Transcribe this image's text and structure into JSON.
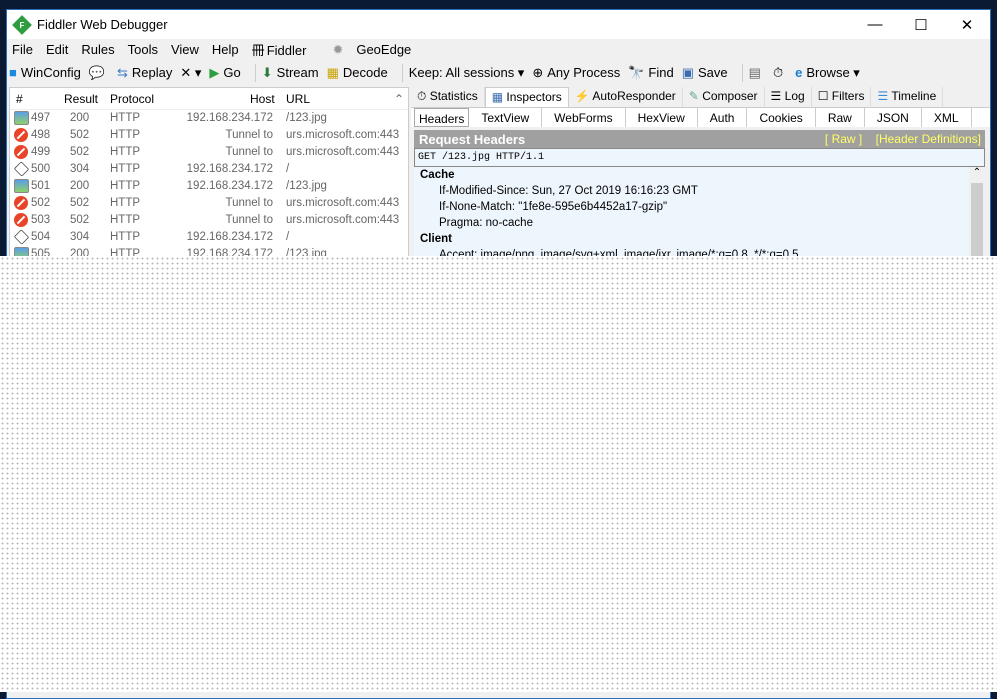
{
  "window": {
    "title": "Fiddler Web Debugger",
    "minimize": "—",
    "maximize": "☐",
    "close": "✕"
  },
  "menu": [
    "File",
    "Edit",
    "Rules",
    "Tools",
    "View",
    "Help",
    "Fiddler",
    "GeoEdge"
  ],
  "toolbar": {
    "winconfig": "WinConfig",
    "replay": "Replay",
    "remove": "✕ ▾",
    "go": "Go",
    "stream": "Stream",
    "decode": "Decode",
    "keep": "Keep: All sessions ▾",
    "process": "Any Process",
    "find": "Find",
    "save": "Save",
    "browse": "Browse ▾"
  },
  "sessions": {
    "columns": [
      "#",
      "Result",
      "Protocol",
      "Host",
      "URL"
    ],
    "rows": [
      {
        "icon": "image",
        "id": "497",
        "result": "200",
        "protocol": "HTTP",
        "host": "192.168.234.172",
        "url": "/123.jpg"
      },
      {
        "icon": "error",
        "id": "498",
        "result": "502",
        "protocol": "HTTP",
        "host": "Tunnel to",
        "url": "urs.microsoft.com:443"
      },
      {
        "icon": "error",
        "id": "499",
        "result": "502",
        "protocol": "HTTP",
        "host": "Tunnel to",
        "url": "urs.microsoft.com:443"
      },
      {
        "icon": "not-modified",
        "id": "500",
        "result": "304",
        "protocol": "HTTP",
        "host": "192.168.234.172",
        "url": "/"
      },
      {
        "icon": "image",
        "id": "501",
        "result": "200",
        "protocol": "HTTP",
        "host": "192.168.234.172",
        "url": "/123.jpg"
      },
      {
        "icon": "error",
        "id": "502",
        "result": "502",
        "protocol": "HTTP",
        "host": "Tunnel to",
        "url": "urs.microsoft.com:443"
      },
      {
        "icon": "error",
        "id": "503",
        "result": "502",
        "protocol": "HTTP",
        "host": "Tunnel to",
        "url": "urs.microsoft.com:443"
      },
      {
        "icon": "not-modified",
        "id": "504",
        "result": "304",
        "protocol": "HTTP",
        "host": "192.168.234.172",
        "url": "/"
      },
      {
        "icon": "image",
        "id": "505",
        "result": "200",
        "protocol": "HTTP",
        "host": "192.168.234.172",
        "url": "/123.jpg"
      }
    ]
  },
  "tabs": [
    "Statistics",
    "Inspectors",
    "AutoResponder",
    "Composer",
    "Log",
    "Filters",
    "Timeline"
  ],
  "subtabs": [
    "Headers",
    "TextView",
    "WebForms",
    "HexView",
    "Auth",
    "Cookies",
    "Raw",
    "JSON",
    "XML"
  ],
  "request": {
    "title": "Request Headers",
    "raw_link": "[ Raw ]",
    "defs_link": "[Header Definitions]",
    "line": "GET /123.jpg HTTP/1.1",
    "groups": [
      {
        "name": "Cache",
        "headers": [
          "If-Modified-Since: Sun, 27 Oct 2019 16:16:23 GMT",
          "If-None-Match: \"1fe8e-595e6b4452a17-gzip\"",
          "Pragma: no-cache"
        ]
      },
      {
        "name": "Client",
        "headers": [
          "Accept: image/png, image/svg+xml, image/jxr, image/*;q=0.8, */*;q=0.5"
        ]
      }
    ]
  }
}
